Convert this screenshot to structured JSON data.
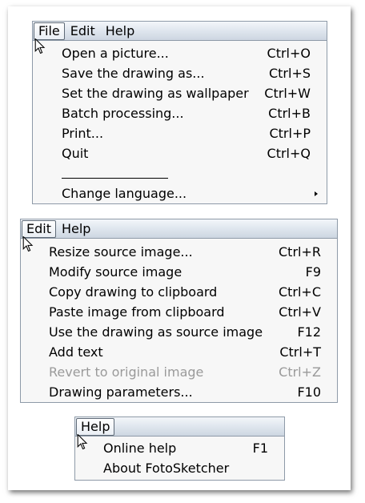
{
  "file_menu": {
    "menubar": [
      "File",
      "Edit",
      "Help"
    ],
    "items": [
      {
        "label": "Open a picture...",
        "shortcut": "Ctrl+O"
      },
      {
        "label": "Save the drawing as...",
        "shortcut": "Ctrl+S"
      },
      {
        "label": "Set the drawing as wallpaper",
        "shortcut": "Ctrl+W"
      },
      {
        "label": "Batch processing...",
        "shortcut": "Ctrl+B"
      },
      {
        "label": "Print...",
        "shortcut": "Ctrl+P"
      },
      {
        "label": "Quit",
        "shortcut": "Ctrl+Q"
      }
    ],
    "submenu_item": {
      "label": "Change language..."
    }
  },
  "edit_menu": {
    "menubar": [
      "Edit",
      "Help"
    ],
    "items": [
      {
        "label": "Resize source image...",
        "shortcut": "Ctrl+R"
      },
      {
        "label": "Modify source image",
        "shortcut": "F9"
      },
      {
        "label": "Copy drawing to clipboard",
        "shortcut": "Ctrl+C"
      },
      {
        "label": "Paste image from clipboard",
        "shortcut": "Ctrl+V"
      },
      {
        "label": "Use the drawing as source image",
        "shortcut": "F12"
      },
      {
        "label": "Add text",
        "shortcut": "Ctrl+T"
      },
      {
        "label": "Revert to original image",
        "shortcut": "Ctrl+Z"
      },
      {
        "label": "Drawing parameters...",
        "shortcut": "F10"
      }
    ]
  },
  "help_menu": {
    "menubar": [
      "Help"
    ],
    "items": [
      {
        "label": "Online help",
        "shortcut": "F1"
      },
      {
        "label": "About FotoSketcher",
        "shortcut": ""
      }
    ]
  }
}
